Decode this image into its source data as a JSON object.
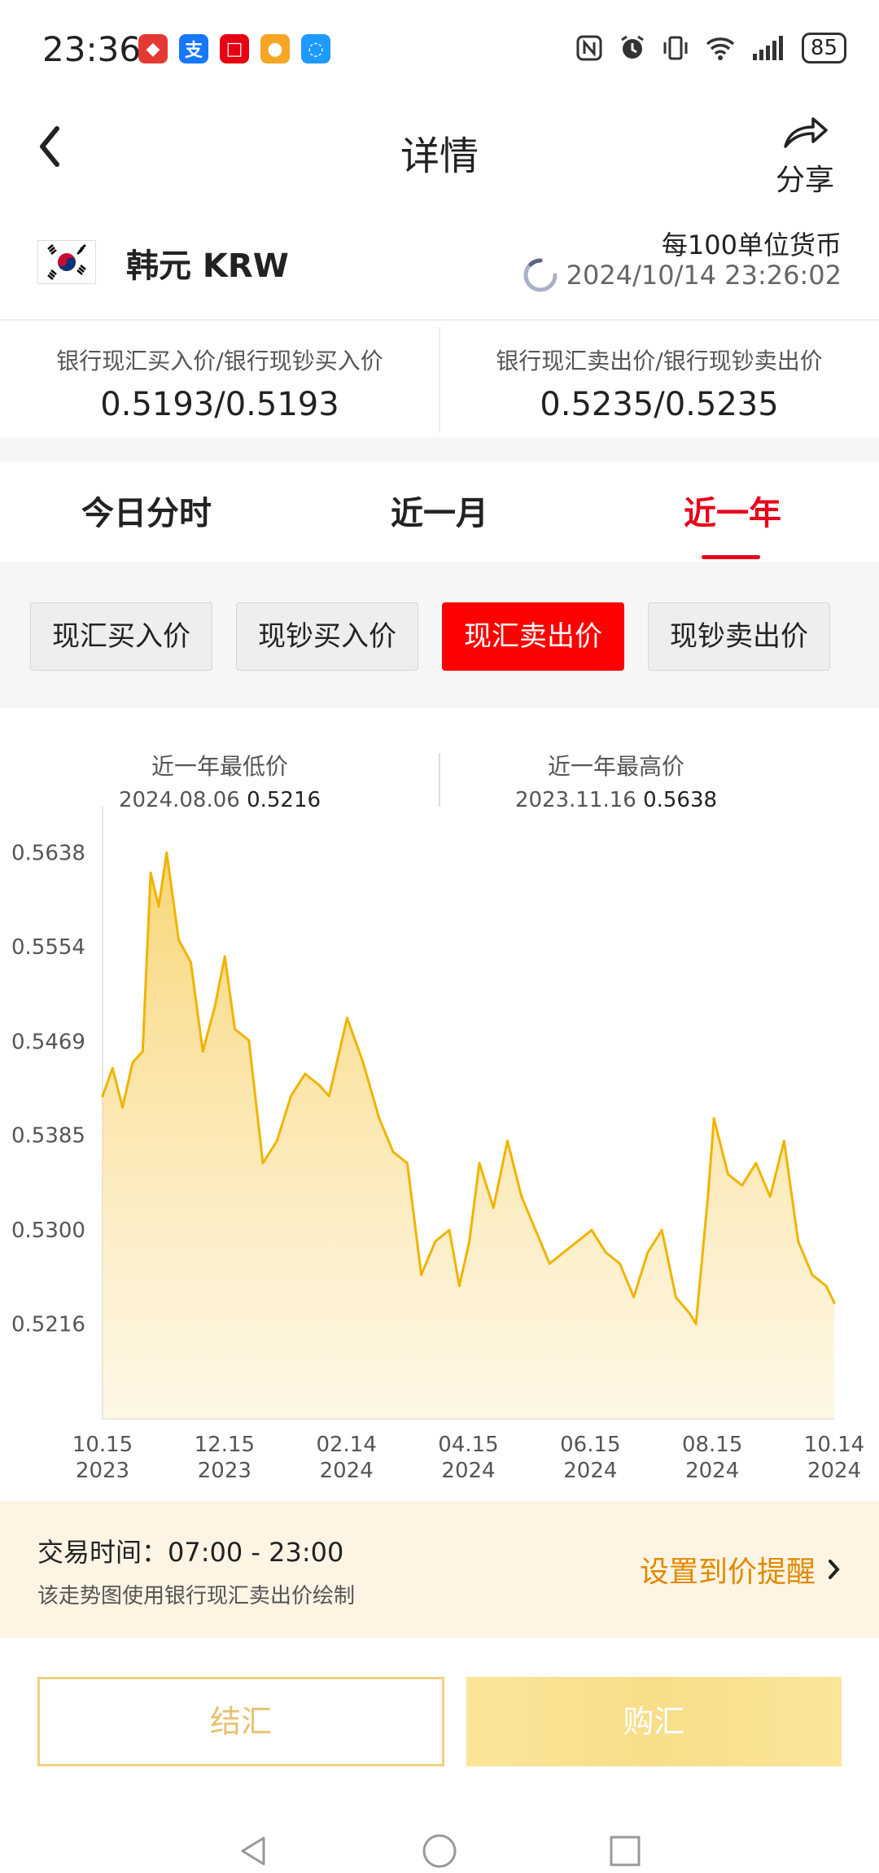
{
  "status_bar": {
    "time": "23:36",
    "battery": "85"
  },
  "header": {
    "title": "详情",
    "share_label": "分享"
  },
  "currency": {
    "name": "韩元 KRW",
    "unit": "每100单位货币",
    "timestamp": "2024/10/14 23:26:02"
  },
  "prices": {
    "buy_label": "银行现汇买入价/银行现钞买入价",
    "buy_value": "0.5193/0.5193",
    "sell_label": "银行现汇卖出价/银行现钞卖出价",
    "sell_value": "0.5235/0.5235"
  },
  "tabs": [
    {
      "label": "今日分时",
      "active": false
    },
    {
      "label": "近一月",
      "active": false
    },
    {
      "label": "近一年",
      "active": true
    }
  ],
  "price_types": [
    {
      "label": "现汇买入价",
      "active": false
    },
    {
      "label": "现钞买入价",
      "active": false
    },
    {
      "label": "现汇卖出价",
      "active": true
    },
    {
      "label": "现钞卖出价",
      "active": false
    }
  ],
  "stats": {
    "low_label": "近一年最低价",
    "low_date": "2024.08.06",
    "low_value": "0.5216",
    "high_label": "近一年最高价",
    "high_date": "2023.11.16",
    "high_value": "0.5638"
  },
  "chart_data": {
    "type": "area",
    "ylim": [
      0.5131,
      0.568
    ],
    "yticks": [
      0.5638,
      0.5554,
      0.5469,
      0.5385,
      0.53,
      0.5216
    ],
    "ytick_labels": [
      "0.5638",
      "0.5554",
      "0.5469",
      "0.5385",
      "0.5300",
      "0.5216"
    ],
    "xticks": [
      {
        "top": "10.15",
        "bottom": "2023"
      },
      {
        "top": "12.15",
        "bottom": "2023"
      },
      {
        "top": "02.14",
        "bottom": "2024"
      },
      {
        "top": "04.15",
        "bottom": "2024"
      },
      {
        "top": "06.15",
        "bottom": "2024"
      },
      {
        "top": "08.15",
        "bottom": "2024"
      },
      {
        "top": "10.14",
        "bottom": "2024"
      }
    ],
    "x": [
      "2023-10-15",
      "2023-10-20",
      "2023-10-25",
      "2023-10-30",
      "2023-11-04",
      "2023-11-08",
      "2023-11-12",
      "2023-11-16",
      "2023-11-22",
      "2023-11-28",
      "2023-12-04",
      "2023-12-10",
      "2023-12-15",
      "2023-12-20",
      "2023-12-27",
      "2024-01-03",
      "2024-01-10",
      "2024-01-17",
      "2024-01-24",
      "2024-01-31",
      "2024-02-05",
      "2024-02-14",
      "2024-02-22",
      "2024-03-01",
      "2024-03-08",
      "2024-03-15",
      "2024-03-22",
      "2024-03-29",
      "2024-04-05",
      "2024-04-10",
      "2024-04-15",
      "2024-04-20",
      "2024-04-27",
      "2024-05-04",
      "2024-05-11",
      "2024-05-18",
      "2024-05-25",
      "2024-06-01",
      "2024-06-08",
      "2024-06-15",
      "2024-06-22",
      "2024-06-29",
      "2024-07-06",
      "2024-07-13",
      "2024-07-20",
      "2024-07-27",
      "2024-08-03",
      "2024-08-06",
      "2024-08-12",
      "2024-08-15",
      "2024-08-22",
      "2024-08-29",
      "2024-09-05",
      "2024-09-12",
      "2024-09-19",
      "2024-09-26",
      "2024-10-03",
      "2024-10-10",
      "2024-10-14"
    ],
    "values": [
      0.542,
      0.5445,
      0.541,
      0.545,
      0.546,
      0.562,
      0.559,
      0.5638,
      0.556,
      0.554,
      0.546,
      0.55,
      0.5545,
      0.548,
      0.547,
      0.536,
      0.538,
      0.542,
      0.544,
      0.543,
      0.542,
      0.549,
      0.545,
      0.54,
      0.537,
      0.536,
      0.526,
      0.529,
      0.53,
      0.525,
      0.529,
      0.536,
      0.532,
      0.538,
      0.533,
      0.53,
      0.527,
      0.528,
      0.529,
      0.53,
      0.528,
      0.527,
      0.524,
      0.528,
      0.53,
      0.524,
      0.5225,
      0.5216,
      0.533,
      0.54,
      0.535,
      0.534,
      0.536,
      0.533,
      0.538,
      0.529,
      0.526,
      0.525,
      0.5235
    ],
    "color": "#f0b400"
  },
  "footer": {
    "trade_time": "交易时间：07:00 - 23:00",
    "note": "该走势图使用银行现汇卖出价绘制",
    "reminder": "设置到价提醒"
  },
  "actions": {
    "settle": "结汇",
    "purchase": "购汇"
  }
}
